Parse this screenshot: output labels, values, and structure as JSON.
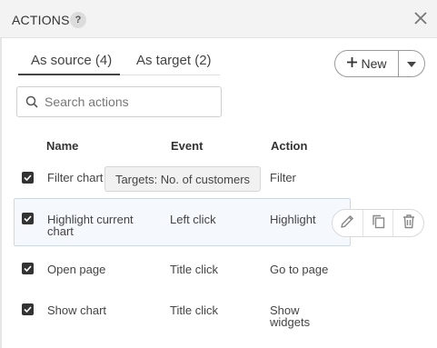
{
  "header": {
    "title": "ACTIONS",
    "help_label": "?"
  },
  "tabs": [
    {
      "label": "As source (4)",
      "active": true
    },
    {
      "label": "As target (2)",
      "active": false
    }
  ],
  "new_button": {
    "label": "New"
  },
  "search": {
    "placeholder": "Search actions",
    "value": ""
  },
  "columns": {
    "name": "Name",
    "event": "Event",
    "action": "Action"
  },
  "rows": [
    {
      "checked": true,
      "name": "Filter chart",
      "event": "",
      "action": "Filter"
    },
    {
      "checked": true,
      "name": "Highlight current chart",
      "event": "Left click",
      "action": "Highlight"
    },
    {
      "checked": true,
      "name": "Open page",
      "event": "Title click",
      "action": "Go to page"
    },
    {
      "checked": true,
      "name": "Show chart",
      "event": "Title click",
      "action": "Show widgets"
    }
  ],
  "tooltip": {
    "text": "Targets: No. of customers"
  },
  "colors": {
    "accent": "#333333",
    "row_highlight": "#f5f8fc",
    "header_bg": "#f3f3f3"
  },
  "icons": [
    "help-icon",
    "close-icon",
    "plus-icon",
    "chevron-down-icon",
    "search-icon",
    "checkbox-checked-icon",
    "pencil-icon",
    "copy-icon",
    "trash-icon"
  ]
}
